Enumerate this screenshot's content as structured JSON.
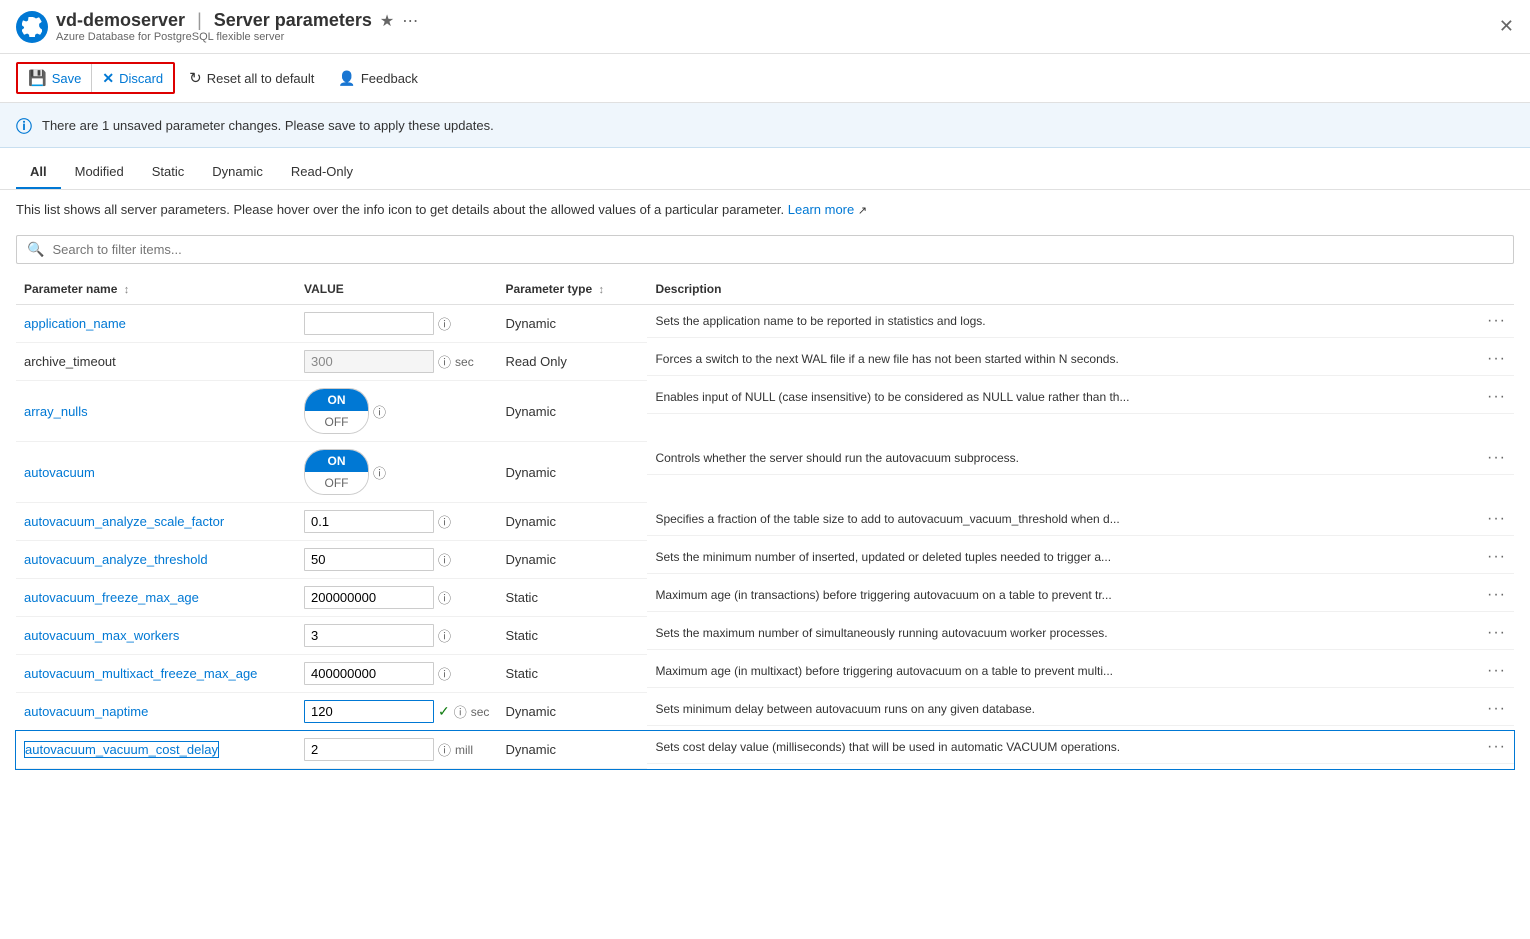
{
  "header": {
    "icon_label": "settings-gear-icon",
    "server_name": "vd-demoserver",
    "page_title": "Server parameters",
    "subtitle": "Azure Database for PostgreSQL flexible server"
  },
  "toolbar": {
    "save_label": "Save",
    "discard_label": "Discard",
    "reset_label": "Reset all to default",
    "feedback_label": "Feedback"
  },
  "banner": {
    "message": "There are 1 unsaved parameter changes.  Please save to apply these updates."
  },
  "tabs": [
    {
      "id": "all",
      "label": "All",
      "active": true
    },
    {
      "id": "modified",
      "label": "Modified",
      "active": false
    },
    {
      "id": "static",
      "label": "Static",
      "active": false
    },
    {
      "id": "dynamic",
      "label": "Dynamic",
      "active": false
    },
    {
      "id": "readonly",
      "label": "Read-Only",
      "active": false
    }
  ],
  "description": "This list shows all server parameters. Please hover over the info icon to get details about the allowed values of a particular parameter.",
  "learn_more": "Learn more",
  "search": {
    "placeholder": "Search to filter items..."
  },
  "table": {
    "columns": [
      {
        "id": "name",
        "label": "Parameter name"
      },
      {
        "id": "value",
        "label": "VALUE"
      },
      {
        "id": "type",
        "label": "Parameter type"
      },
      {
        "id": "description",
        "label": "Description"
      }
    ],
    "rows": [
      {
        "name": "application_name",
        "is_link": true,
        "value": "",
        "value_type": "text",
        "unit": "",
        "param_type": "Dynamic",
        "description": "Sets the application name to be reported in statistics and logs.",
        "modified": false,
        "highlighted": false
      },
      {
        "name": "archive_timeout",
        "is_link": false,
        "value": "300",
        "value_type": "text",
        "unit": "sec",
        "param_type": "Read Only",
        "description": "Forces a switch to the next WAL file if a new file has not been started within N seconds.",
        "modified": false,
        "readonly": true,
        "highlighted": false
      },
      {
        "name": "array_nulls",
        "is_link": true,
        "value_type": "toggle",
        "toggle_on": true,
        "unit": "",
        "param_type": "Dynamic",
        "description": "Enables input of NULL (case insensitive) to be considered as NULL value rather than th...",
        "modified": false,
        "highlighted": false
      },
      {
        "name": "autovacuum",
        "is_link": true,
        "value_type": "toggle",
        "toggle_on": true,
        "unit": "",
        "param_type": "Dynamic",
        "description": "Controls whether the server should run the autovacuum subprocess.",
        "modified": false,
        "highlighted": false
      },
      {
        "name": "autovacuum_analyze_scale_factor",
        "is_link": true,
        "value": "0.1",
        "value_type": "text",
        "unit": "",
        "param_type": "Dynamic",
        "description": "Specifies a fraction of the table size to add to autovacuum_vacuum_threshold when d...",
        "modified": false,
        "highlighted": false
      },
      {
        "name": "autovacuum_analyze_threshold",
        "is_link": true,
        "value": "50",
        "value_type": "text",
        "unit": "",
        "param_type": "Dynamic",
        "description": "Sets the minimum number of inserted, updated or deleted tuples needed to trigger a...",
        "modified": false,
        "highlighted": false
      },
      {
        "name": "autovacuum_freeze_max_age",
        "is_link": true,
        "value": "200000000",
        "value_type": "text",
        "unit": "",
        "param_type": "Static",
        "description": "Maximum age (in transactions) before triggering autovacuum on a table to prevent tr...",
        "modified": false,
        "highlighted": false
      },
      {
        "name": "autovacuum_max_workers",
        "is_link": true,
        "value": "3",
        "value_type": "text",
        "unit": "",
        "param_type": "Static",
        "description": "Sets the maximum number of simultaneously running autovacuum worker processes.",
        "modified": false,
        "highlighted": false
      },
      {
        "name": "autovacuum_multixact_freeze_max_age",
        "is_link": true,
        "value": "400000000",
        "value_type": "text",
        "unit": "",
        "param_type": "Static",
        "description": "Maximum age (in multixact) before triggering autovacuum on a table to prevent multi...",
        "modified": false,
        "highlighted": false
      },
      {
        "name": "autovacuum_naptime",
        "is_link": true,
        "value": "120",
        "value_type": "text",
        "unit": "sec",
        "param_type": "Dynamic",
        "description": "Sets minimum delay between autovacuum runs on any given database.",
        "modified": true,
        "highlighted": false
      },
      {
        "name": "autovacuum_vacuum_cost_delay",
        "is_link": true,
        "value": "2",
        "value_type": "text",
        "unit": "mill",
        "param_type": "Dynamic",
        "description": "Sets cost delay value (milliseconds) that will be used in automatic VACUUM operations.",
        "modified": false,
        "highlighted": true
      }
    ]
  }
}
